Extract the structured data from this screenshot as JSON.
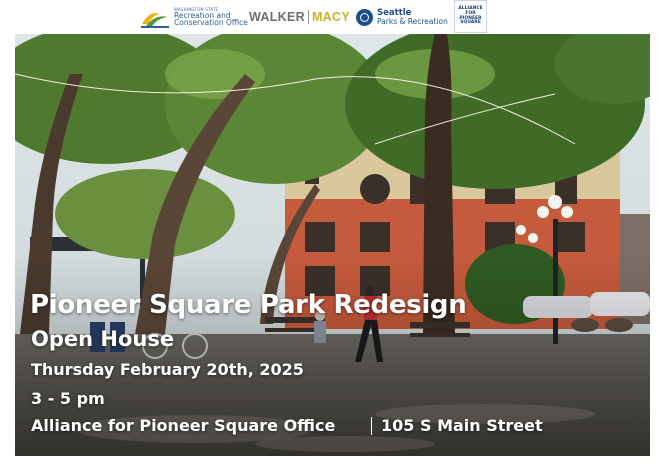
{
  "logos": {
    "rco": {
      "small": "WASHINGTON STATE",
      "line1": "Recreation and",
      "line2": "Conservation Office"
    },
    "walker_macy": {
      "part1": "WALKER",
      "part2": "MACY"
    },
    "seattle_parks": {
      "line1": "Seattle",
      "line2": "Parks & Recreation"
    },
    "alliance": {
      "line1": "ALLIANCE",
      "line2": "FOR",
      "line3": "PIONEER",
      "line4": "SQUARE"
    }
  },
  "event": {
    "title": "Pioneer Square Park Redesign",
    "subtitle": "Open House",
    "date": "Thursday February 20th, 2025",
    "time": "3 - 5 pm",
    "location": "Alliance for Pioneer Square Office",
    "address": "105 S Main Street"
  },
  "colors": {
    "walker": "#6e6e6e",
    "macy": "#c7b22a",
    "seattle_blue": "#1d4f8f",
    "rco_blue": "#2e5f9a"
  }
}
